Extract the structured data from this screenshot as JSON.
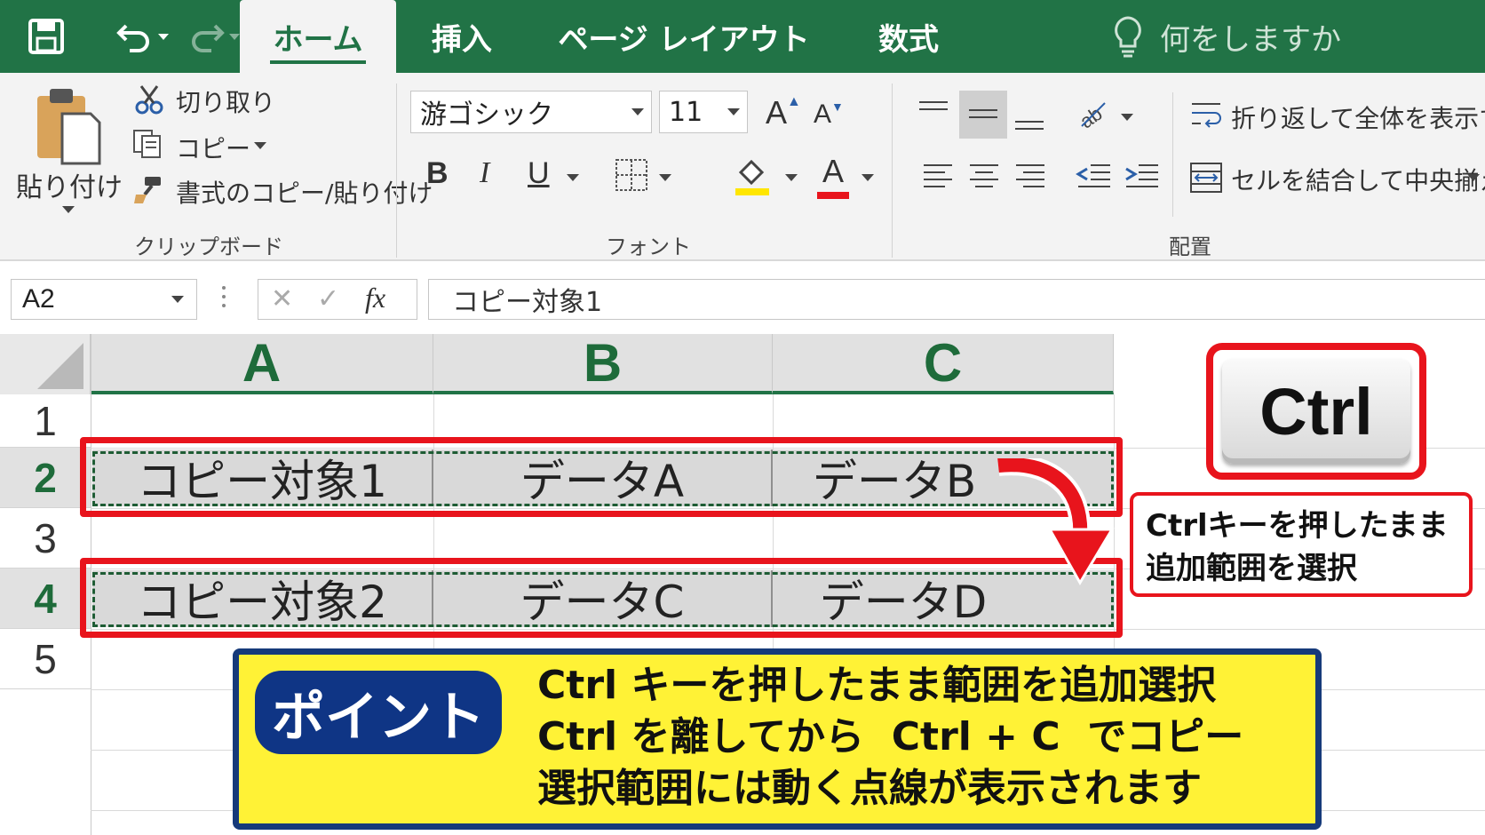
{
  "tabs": [
    {
      "label": "ホーム",
      "active": true
    },
    {
      "label": "挿入",
      "active": false
    },
    {
      "label": "ページ レイアウト",
      "active": false
    },
    {
      "label": "数式",
      "active": false
    }
  ],
  "tell_me": "何をしますか",
  "clipboard": {
    "paste": "貼り付け",
    "cut": "切り取り",
    "copy": "コピー",
    "format_painter": "書式のコピー/貼り付け",
    "label": "クリップボード"
  },
  "font": {
    "name": "游ゴシック",
    "size": "11",
    "bold": "B",
    "italic": "I",
    "underline": "U",
    "grow": "A",
    "shrink": "A",
    "color_glyph": "A",
    "label": "フォント",
    "fill_color": "#ffe600",
    "font_color": "#e8141c"
  },
  "alignment": {
    "wrap": "折り返して全体を表示する",
    "merge": "セルを結合して中央揃え",
    "label": "配置"
  },
  "formula_bar": {
    "name_box": "A2",
    "fx": "fx",
    "content": "コピー対象1"
  },
  "columns": [
    "A",
    "B",
    "C"
  ],
  "rows": [
    "1",
    "2",
    "3",
    "4",
    "5"
  ],
  "cells": {
    "row2": [
      "コピー対象1",
      "データA",
      "データB"
    ],
    "row4": [
      "コピー対象2",
      "データC",
      "データD"
    ]
  },
  "ctrl_key": "Ctrl",
  "callout": [
    "Ctrlキーを押したまま",
    "追加範囲を選択"
  ],
  "point": {
    "badge": "ポイント",
    "lines": [
      "Ctrl キーを押したまま範囲を追加選択",
      "Ctrl を離してから  Ctrl + C  でコピー",
      "選択範囲には動く点線が表示されます"
    ]
  },
  "colors": {
    "excel_green": "#217346",
    "highlight_red": "#e8141c",
    "point_yellow": "#fff236",
    "point_navy": "#0f3585"
  }
}
